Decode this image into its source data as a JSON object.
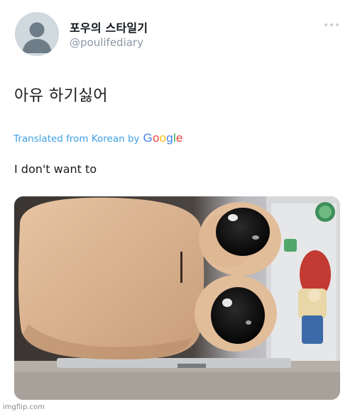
{
  "tweet": {
    "author_name": "포우의 스타일기",
    "author_handle": "@poulifediary",
    "avatar_icon": "default-avatar-icon",
    "more_icon": "more-options-icon",
    "text": "아유 하기싫어",
    "translation": {
      "prefix": "Translated from Korean by",
      "provider_logo_text": "Google",
      "text": "I don't want to"
    },
    "media": {
      "kind": "photo"
    }
  },
  "watermark": "imgflip.com",
  "colors": {
    "translation_link": "#1d9bf0",
    "handle": "#8a98a5",
    "avatar_bg": "#cfd9de",
    "google_blue": "#4285f4",
    "google_red": "#ea4335",
    "google_yellow": "#fbbc05",
    "google_green": "#34a853"
  }
}
